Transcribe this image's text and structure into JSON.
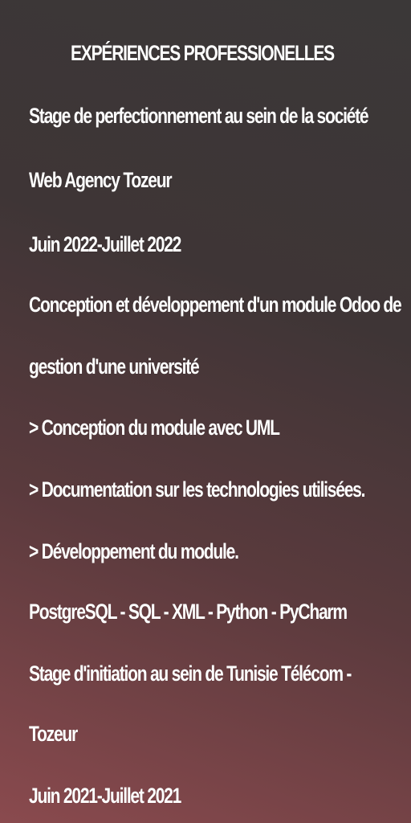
{
  "section_title": "EXPÉRIENCES PROFESSIONELLES",
  "experiences": [
    {
      "title": "Stage de perfectionnement au sein de la société",
      "company": "Web Agency Tozeur",
      "period": "Juin 2022-Juillet 2022",
      "project_line1": "Conception et développement d'un module Odoo de",
      "project_line2": "gestion d'une université",
      "tasks": [
        "> Conception du module avec UML",
        "> Documentation sur les technologies utilisées.",
        "> Développement du module."
      ],
      "technologies": "PostgreSQL - SQL - XML - Python - PyCharm"
    },
    {
      "title": "Stage d'initiation au sein de Tunisie Télécom -",
      "company": "Tozeur",
      "period": "Juin 2021-Juillet 2021"
    }
  ]
}
